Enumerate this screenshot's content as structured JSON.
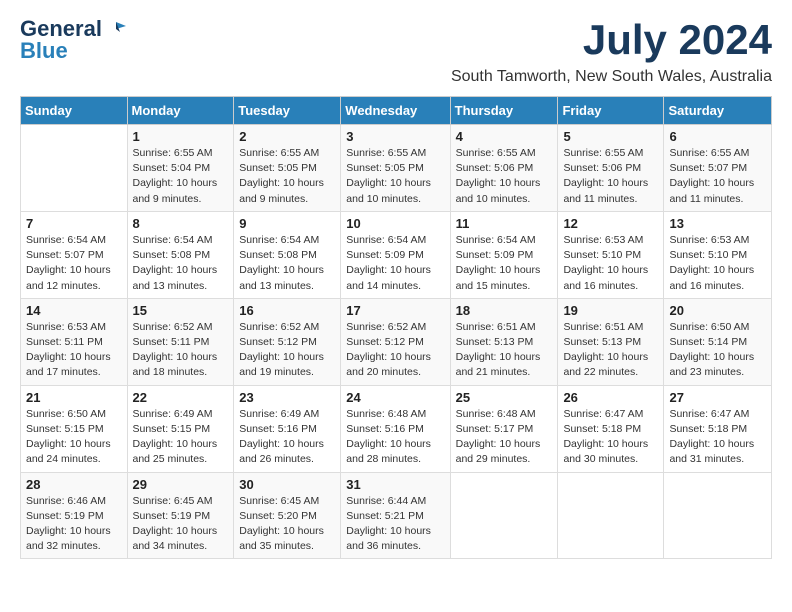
{
  "logo": {
    "line1": "General",
    "line2": "Blue"
  },
  "title": "July 2024",
  "subtitle": "South Tamworth, New South Wales, Australia",
  "days_of_week": [
    "Sunday",
    "Monday",
    "Tuesday",
    "Wednesday",
    "Thursday",
    "Friday",
    "Saturday"
  ],
  "weeks": [
    [
      {
        "day": "",
        "info": ""
      },
      {
        "day": "1",
        "info": "Sunrise: 6:55 AM\nSunset: 5:04 PM\nDaylight: 10 hours\nand 9 minutes."
      },
      {
        "day": "2",
        "info": "Sunrise: 6:55 AM\nSunset: 5:05 PM\nDaylight: 10 hours\nand 9 minutes."
      },
      {
        "day": "3",
        "info": "Sunrise: 6:55 AM\nSunset: 5:05 PM\nDaylight: 10 hours\nand 10 minutes."
      },
      {
        "day": "4",
        "info": "Sunrise: 6:55 AM\nSunset: 5:06 PM\nDaylight: 10 hours\nand 10 minutes."
      },
      {
        "day": "5",
        "info": "Sunrise: 6:55 AM\nSunset: 5:06 PM\nDaylight: 10 hours\nand 11 minutes."
      },
      {
        "day": "6",
        "info": "Sunrise: 6:55 AM\nSunset: 5:07 PM\nDaylight: 10 hours\nand 11 minutes."
      }
    ],
    [
      {
        "day": "7",
        "info": "Sunrise: 6:54 AM\nSunset: 5:07 PM\nDaylight: 10 hours\nand 12 minutes."
      },
      {
        "day": "8",
        "info": "Sunrise: 6:54 AM\nSunset: 5:08 PM\nDaylight: 10 hours\nand 13 minutes."
      },
      {
        "day": "9",
        "info": "Sunrise: 6:54 AM\nSunset: 5:08 PM\nDaylight: 10 hours\nand 13 minutes."
      },
      {
        "day": "10",
        "info": "Sunrise: 6:54 AM\nSunset: 5:09 PM\nDaylight: 10 hours\nand 14 minutes."
      },
      {
        "day": "11",
        "info": "Sunrise: 6:54 AM\nSunset: 5:09 PM\nDaylight: 10 hours\nand 15 minutes."
      },
      {
        "day": "12",
        "info": "Sunrise: 6:53 AM\nSunset: 5:10 PM\nDaylight: 10 hours\nand 16 minutes."
      },
      {
        "day": "13",
        "info": "Sunrise: 6:53 AM\nSunset: 5:10 PM\nDaylight: 10 hours\nand 16 minutes."
      }
    ],
    [
      {
        "day": "14",
        "info": "Sunrise: 6:53 AM\nSunset: 5:11 PM\nDaylight: 10 hours\nand 17 minutes."
      },
      {
        "day": "15",
        "info": "Sunrise: 6:52 AM\nSunset: 5:11 PM\nDaylight: 10 hours\nand 18 minutes."
      },
      {
        "day": "16",
        "info": "Sunrise: 6:52 AM\nSunset: 5:12 PM\nDaylight: 10 hours\nand 19 minutes."
      },
      {
        "day": "17",
        "info": "Sunrise: 6:52 AM\nSunset: 5:12 PM\nDaylight: 10 hours\nand 20 minutes."
      },
      {
        "day": "18",
        "info": "Sunrise: 6:51 AM\nSunset: 5:13 PM\nDaylight: 10 hours\nand 21 minutes."
      },
      {
        "day": "19",
        "info": "Sunrise: 6:51 AM\nSunset: 5:13 PM\nDaylight: 10 hours\nand 22 minutes."
      },
      {
        "day": "20",
        "info": "Sunrise: 6:50 AM\nSunset: 5:14 PM\nDaylight: 10 hours\nand 23 minutes."
      }
    ],
    [
      {
        "day": "21",
        "info": "Sunrise: 6:50 AM\nSunset: 5:15 PM\nDaylight: 10 hours\nand 24 minutes."
      },
      {
        "day": "22",
        "info": "Sunrise: 6:49 AM\nSunset: 5:15 PM\nDaylight: 10 hours\nand 25 minutes."
      },
      {
        "day": "23",
        "info": "Sunrise: 6:49 AM\nSunset: 5:16 PM\nDaylight: 10 hours\nand 26 minutes."
      },
      {
        "day": "24",
        "info": "Sunrise: 6:48 AM\nSunset: 5:16 PM\nDaylight: 10 hours\nand 28 minutes."
      },
      {
        "day": "25",
        "info": "Sunrise: 6:48 AM\nSunset: 5:17 PM\nDaylight: 10 hours\nand 29 minutes."
      },
      {
        "day": "26",
        "info": "Sunrise: 6:47 AM\nSunset: 5:18 PM\nDaylight: 10 hours\nand 30 minutes."
      },
      {
        "day": "27",
        "info": "Sunrise: 6:47 AM\nSunset: 5:18 PM\nDaylight: 10 hours\nand 31 minutes."
      }
    ],
    [
      {
        "day": "28",
        "info": "Sunrise: 6:46 AM\nSunset: 5:19 PM\nDaylight: 10 hours\nand 32 minutes."
      },
      {
        "day": "29",
        "info": "Sunrise: 6:45 AM\nSunset: 5:19 PM\nDaylight: 10 hours\nand 34 minutes."
      },
      {
        "day": "30",
        "info": "Sunrise: 6:45 AM\nSunset: 5:20 PM\nDaylight: 10 hours\nand 35 minutes."
      },
      {
        "day": "31",
        "info": "Sunrise: 6:44 AM\nSunset: 5:21 PM\nDaylight: 10 hours\nand 36 minutes."
      },
      {
        "day": "",
        "info": ""
      },
      {
        "day": "",
        "info": ""
      },
      {
        "day": "",
        "info": ""
      }
    ]
  ]
}
